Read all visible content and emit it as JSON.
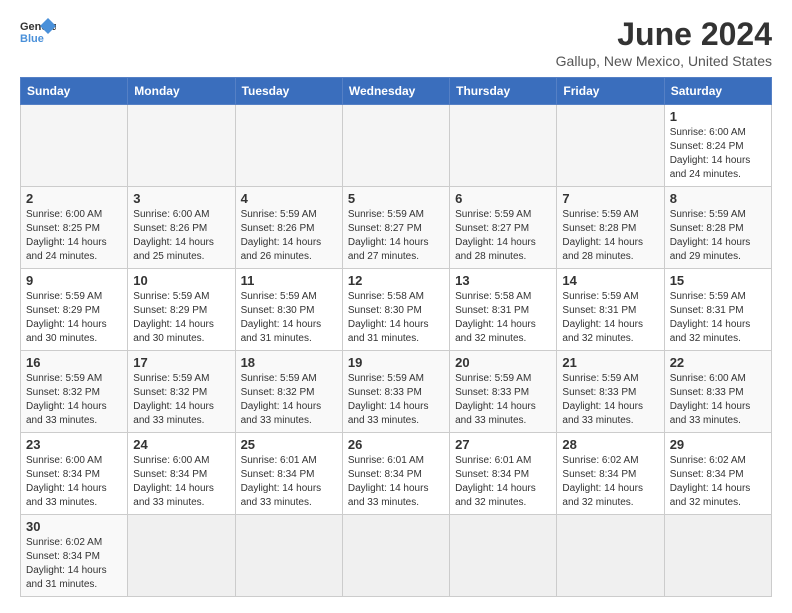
{
  "header": {
    "logo_general": "General",
    "logo_blue": "Blue",
    "month_title": "June 2024",
    "location": "Gallup, New Mexico, United States"
  },
  "weekdays": [
    "Sunday",
    "Monday",
    "Tuesday",
    "Wednesday",
    "Thursday",
    "Friday",
    "Saturday"
  ],
  "weeks": [
    [
      {
        "day": "",
        "info": ""
      },
      {
        "day": "",
        "info": ""
      },
      {
        "day": "",
        "info": ""
      },
      {
        "day": "",
        "info": ""
      },
      {
        "day": "",
        "info": ""
      },
      {
        "day": "",
        "info": ""
      },
      {
        "day": "1",
        "info": "Sunrise: 6:00 AM\nSunset: 8:24 PM\nDaylight: 14 hours and 24 minutes."
      }
    ],
    [
      {
        "day": "2",
        "info": "Sunrise: 6:00 AM\nSunset: 8:25 PM\nDaylight: 14 hours and 24 minutes."
      },
      {
        "day": "3",
        "info": "Sunrise: 6:00 AM\nSunset: 8:26 PM\nDaylight: 14 hours and 25 minutes."
      },
      {
        "day": "4",
        "info": "Sunrise: 5:59 AM\nSunset: 8:26 PM\nDaylight: 14 hours and 26 minutes."
      },
      {
        "day": "5",
        "info": "Sunrise: 5:59 AM\nSunset: 8:27 PM\nDaylight: 14 hours and 27 minutes."
      },
      {
        "day": "6",
        "info": "Sunrise: 5:59 AM\nSunset: 8:27 PM\nDaylight: 14 hours and 28 minutes."
      },
      {
        "day": "7",
        "info": "Sunrise: 5:59 AM\nSunset: 8:28 PM\nDaylight: 14 hours and 28 minutes."
      },
      {
        "day": "8",
        "info": "Sunrise: 5:59 AM\nSunset: 8:28 PM\nDaylight: 14 hours and 29 minutes."
      }
    ],
    [
      {
        "day": "9",
        "info": "Sunrise: 5:59 AM\nSunset: 8:29 PM\nDaylight: 14 hours and 30 minutes."
      },
      {
        "day": "10",
        "info": "Sunrise: 5:59 AM\nSunset: 8:29 PM\nDaylight: 14 hours and 30 minutes."
      },
      {
        "day": "11",
        "info": "Sunrise: 5:59 AM\nSunset: 8:30 PM\nDaylight: 14 hours and 31 minutes."
      },
      {
        "day": "12",
        "info": "Sunrise: 5:58 AM\nSunset: 8:30 PM\nDaylight: 14 hours and 31 minutes."
      },
      {
        "day": "13",
        "info": "Sunrise: 5:58 AM\nSunset: 8:31 PM\nDaylight: 14 hours and 32 minutes."
      },
      {
        "day": "14",
        "info": "Sunrise: 5:59 AM\nSunset: 8:31 PM\nDaylight: 14 hours and 32 minutes."
      },
      {
        "day": "15",
        "info": "Sunrise: 5:59 AM\nSunset: 8:31 PM\nDaylight: 14 hours and 32 minutes."
      }
    ],
    [
      {
        "day": "16",
        "info": "Sunrise: 5:59 AM\nSunset: 8:32 PM\nDaylight: 14 hours and 33 minutes."
      },
      {
        "day": "17",
        "info": "Sunrise: 5:59 AM\nSunset: 8:32 PM\nDaylight: 14 hours and 33 minutes."
      },
      {
        "day": "18",
        "info": "Sunrise: 5:59 AM\nSunset: 8:32 PM\nDaylight: 14 hours and 33 minutes."
      },
      {
        "day": "19",
        "info": "Sunrise: 5:59 AM\nSunset: 8:33 PM\nDaylight: 14 hours and 33 minutes."
      },
      {
        "day": "20",
        "info": "Sunrise: 5:59 AM\nSunset: 8:33 PM\nDaylight: 14 hours and 33 minutes."
      },
      {
        "day": "21",
        "info": "Sunrise: 5:59 AM\nSunset: 8:33 PM\nDaylight: 14 hours and 33 minutes."
      },
      {
        "day": "22",
        "info": "Sunrise: 6:00 AM\nSunset: 8:33 PM\nDaylight: 14 hours and 33 minutes."
      }
    ],
    [
      {
        "day": "23",
        "info": "Sunrise: 6:00 AM\nSunset: 8:34 PM\nDaylight: 14 hours and 33 minutes."
      },
      {
        "day": "24",
        "info": "Sunrise: 6:00 AM\nSunset: 8:34 PM\nDaylight: 14 hours and 33 minutes."
      },
      {
        "day": "25",
        "info": "Sunrise: 6:01 AM\nSunset: 8:34 PM\nDaylight: 14 hours and 33 minutes."
      },
      {
        "day": "26",
        "info": "Sunrise: 6:01 AM\nSunset: 8:34 PM\nDaylight: 14 hours and 33 minutes."
      },
      {
        "day": "27",
        "info": "Sunrise: 6:01 AM\nSunset: 8:34 PM\nDaylight: 14 hours and 32 minutes."
      },
      {
        "day": "28",
        "info": "Sunrise: 6:02 AM\nSunset: 8:34 PM\nDaylight: 14 hours and 32 minutes."
      },
      {
        "day": "29",
        "info": "Sunrise: 6:02 AM\nSunset: 8:34 PM\nDaylight: 14 hours and 32 minutes."
      }
    ],
    [
      {
        "day": "30",
        "info": "Sunrise: 6:02 AM\nSunset: 8:34 PM\nDaylight: 14 hours and 31 minutes."
      },
      {
        "day": "",
        "info": ""
      },
      {
        "day": "",
        "info": ""
      },
      {
        "day": "",
        "info": ""
      },
      {
        "day": "",
        "info": ""
      },
      {
        "day": "",
        "info": ""
      },
      {
        "day": "",
        "info": ""
      }
    ]
  ]
}
